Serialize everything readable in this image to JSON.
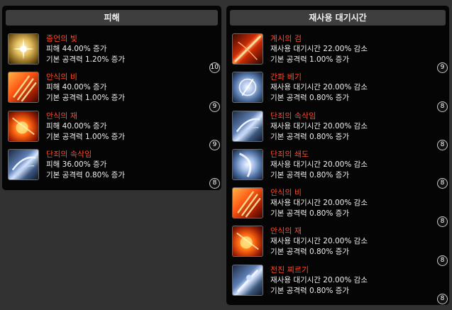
{
  "damage_panel": {
    "title": "피해",
    "items": [
      {
        "name": "종언의 빛",
        "level": "10",
        "line1": "피해 44.00% 증가",
        "line2": "기본 공격력 1.20% 증가",
        "icon": "holy-light-icon"
      },
      {
        "name": "안식의 비",
        "level": "9",
        "line1": "피해 40.00% 증가",
        "line2": "기본 공격력 1.00% 증가",
        "icon": "fire-rain-icon"
      },
      {
        "name": "안식의 재",
        "level": "9",
        "line1": "피해 40.00% 증가",
        "line2": "기본 공격력 1.00% 증가",
        "icon": "ash-burst-icon"
      },
      {
        "name": "단죄의 속삭임",
        "level": "8",
        "line1": "피해 36.00% 증가",
        "line2": "기본 공격력 0.80% 증가",
        "icon": "whisper-slash-icon"
      }
    ]
  },
  "cooldown_panel": {
    "title": "재사용 대기시간",
    "items": [
      {
        "name": "계시의 검",
        "level": "9",
        "line1": "재사용 대기시간 22.00% 감소",
        "line2": "기본 공격력 1.00% 증가",
        "icon": "revelation-sword-icon"
      },
      {
        "name": "간파 베기",
        "level": "8",
        "line1": "재사용 대기시간 20.00% 감소",
        "line2": "기본 공격력 0.80% 증가",
        "icon": "insight-cut-icon"
      },
      {
        "name": "단죄의 속삭임",
        "level": "8",
        "line1": "재사용 대기시간 20.00% 감소",
        "line2": "기본 공격력 0.80% 증가",
        "icon": "whisper-slash-icon"
      },
      {
        "name": "단죄의 쇄도",
        "level": "8",
        "line1": "재사용 대기시간 20.00% 감소",
        "line2": "기본 공격력 0.80% 증가",
        "icon": "judgment-rush-icon"
      },
      {
        "name": "안식의 비",
        "level": "8",
        "line1": "재사용 대기시간 20.00% 감소",
        "line2": "기본 공격력 0.80% 증가",
        "icon": "fire-rain-icon"
      },
      {
        "name": "안식의 재",
        "level": "8",
        "line1": "재사용 대기시간 20.00% 감소",
        "line2": "기본 공격력 0.80% 증가",
        "icon": "ash-burst-icon"
      },
      {
        "name": "전진 찌르기",
        "level": "8",
        "line1": "재사용 대기시간 20.00% 감소",
        "line2": "기본 공격력 0.80% 증가",
        "icon": "forward-thrust-icon"
      }
    ]
  },
  "colors": {
    "background": "#323232",
    "panel": "#050505",
    "header": "#3e3e3e",
    "skill_name": "#ff4a2a",
    "text": "#f0f0f0"
  }
}
